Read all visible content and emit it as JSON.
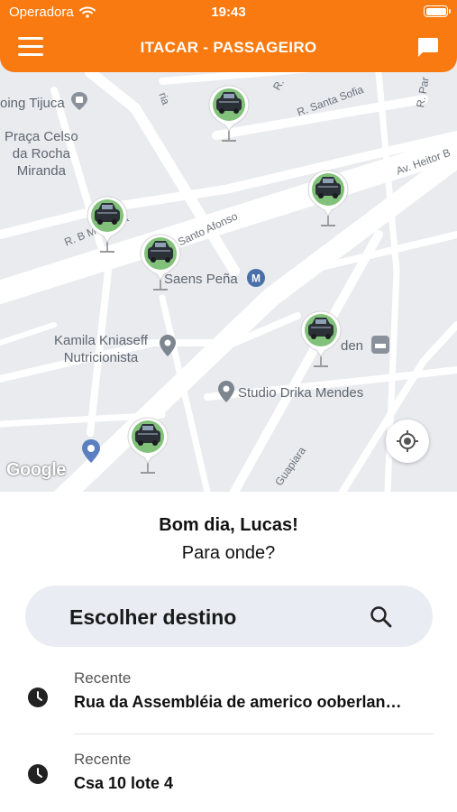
{
  "status_bar": {
    "carrier": "Operadora",
    "time": "19:43"
  },
  "header": {
    "title": "ITACAR - PASSAGEIRO",
    "menu_icon": "hamburger-menu-icon",
    "chat_icon": "chat-bubble-icon",
    "color": "#f97a10"
  },
  "map": {
    "places": {
      "tijuca": "oing Tijuca",
      "praca": "Praça Celso\nda Rocha\nMiranda",
      "saens": "Saens Peña",
      "kamila": "Kamila Kniaseff\nNutricionista",
      "studio": "Studio Drika Mendes",
      "eden": "den"
    },
    "streets": {
      "santa_sofia": "R. Santa Sofia",
      "heitor": "Av. Heitor B",
      "mesquita": "R. B     Mesquita",
      "santo_afonso": "Santo Afonso",
      "guapiara": "Guapiara",
      "r_top": "R.",
      "ria": "ria",
      "r_par": "R. Par"
    },
    "attribution": "Google",
    "car_icon": "car-marker-icon",
    "locate_icon": "my-location-icon"
  },
  "sheet": {
    "greeting": "Bom dia, Lucas!",
    "question": "Para onde?",
    "destination_label": "Escolher destino",
    "search_icon": "search-icon",
    "recents": [
      {
        "kind": "Recente",
        "address": "Rua da Assembléia de americo ooberlan…",
        "icon": "clock-icon"
      },
      {
        "kind": "Recente",
        "address": "Csa 10 lote 4",
        "icon": "clock-icon"
      }
    ]
  }
}
